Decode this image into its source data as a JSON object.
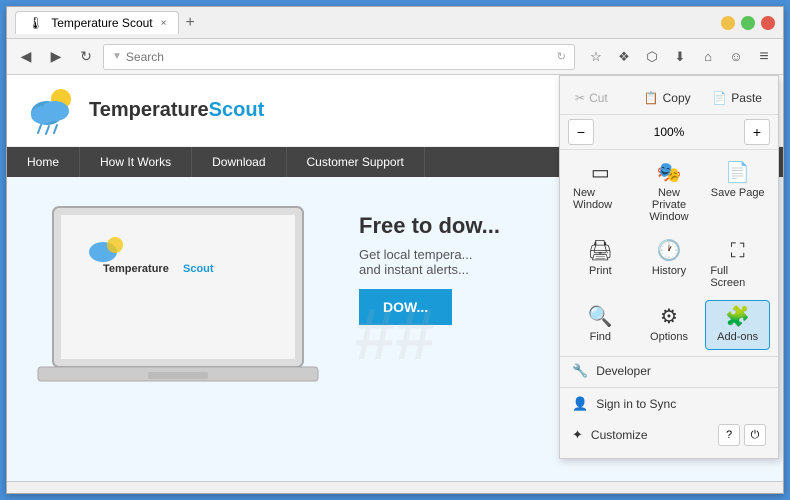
{
  "window": {
    "title": "Temperature Scout",
    "tab_label": "Temperature Scout",
    "close_label": "×",
    "minimize_label": "−",
    "maximize_label": "□",
    "add_tab_label": "+"
  },
  "navbar": {
    "back_label": "◀",
    "forward_label": "▶",
    "reload_label": "↻",
    "search_placeholder": "Search",
    "bookmark_icon": "☆",
    "reading_icon": "❖",
    "pocket_icon": "⬡",
    "download_icon": "⬇",
    "home_icon": "⌂",
    "sync_icon": "☺",
    "menu_icon": "≡"
  },
  "menu": {
    "cut_label": "Cut",
    "copy_label": "Copy",
    "paste_label": "Paste",
    "zoom_value": "100%",
    "zoom_minus": "−",
    "zoom_plus": "+",
    "items": [
      {
        "id": "new-window",
        "icon": "▭",
        "label": "New Window"
      },
      {
        "id": "new-private-window",
        "icon": "🎭",
        "label": "New Private Window"
      },
      {
        "id": "save-page",
        "icon": "📄",
        "label": "Save Page"
      },
      {
        "id": "print",
        "icon": "🖨",
        "label": "Print"
      },
      {
        "id": "history",
        "icon": "🕐",
        "label": "History"
      },
      {
        "id": "full-screen",
        "icon": "⛶",
        "label": "Full Screen"
      },
      {
        "id": "find",
        "icon": "🔍",
        "label": "Find"
      },
      {
        "id": "options",
        "icon": "⚙",
        "label": "Options"
      },
      {
        "id": "add-ons",
        "icon": "🧩",
        "label": "Add-ons"
      }
    ],
    "developer_label": "Developer",
    "developer_icon": "🔧",
    "sign_in_label": "Sign in to Sync",
    "sign_in_icon": "👤",
    "customize_label": "Customize",
    "customize_icon": "✦",
    "help_icon": "?",
    "power_icon": "⏻"
  },
  "site": {
    "logo_text_black": "Temperature",
    "logo_text_blue": "Scout",
    "nav_items": [
      "Home",
      "How It Works",
      "Download",
      "Customer Support"
    ],
    "headline": "Free to dow...",
    "subtext_line1": "Get local tempera...",
    "subtext_line2": "and instant alerts...",
    "cta_label": "DOW...",
    "watermark": "##"
  }
}
